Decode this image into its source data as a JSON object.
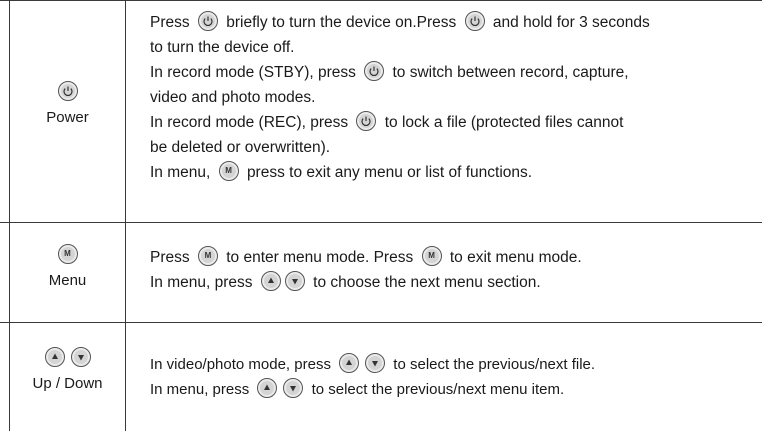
{
  "rows": [
    {
      "label": "Power",
      "icon": "power-icon",
      "lines": [
        [
          "Press",
          "briefly to turn the device on.Press",
          "and hold for 3 seconds"
        ],
        [
          "to turn the device off."
        ],
        [
          "In record mode (STBY), press",
          "to switch between record, capture,"
        ],
        [
          "video and photo modes."
        ],
        [
          "In record mode (REC), press",
          "to lock a file (protected files cannot"
        ],
        [
          "be deleted or overwritten)."
        ],
        [
          "In menu,",
          "press to exit any menu or list of functions."
        ]
      ]
    },
    {
      "label": "Menu",
      "icon": "menu-m-icon",
      "menu_glyph": "M",
      "lines": [
        [
          "Press",
          "to enter menu mode. Press",
          "to exit menu mode."
        ],
        [
          "In menu, press",
          "to choose the next menu section."
        ]
      ]
    },
    {
      "label": "Up / Down",
      "icon": "up-down-icons",
      "lines": [
        [
          "In video/photo mode, press",
          "to select the previous/next file."
        ],
        [
          "In menu, press",
          "to select the previous/next menu item."
        ]
      ]
    }
  ],
  "colors": {
    "button_fill": "#d4d4d4",
    "border": "#3a3a3a"
  }
}
